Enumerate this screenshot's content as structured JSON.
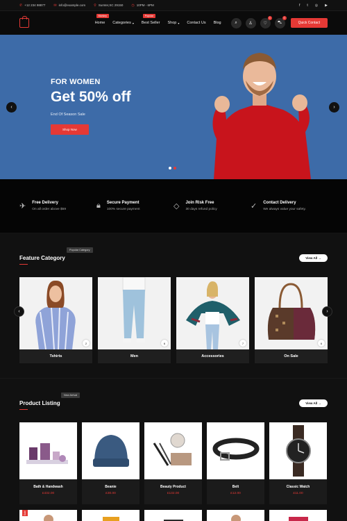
{
  "topbar": {
    "phone": "+12 234 98877",
    "email": "info@example.com",
    "location": "Sumter,SC 29150",
    "hours": "10PM - 6PM",
    "social": [
      "f",
      "t",
      "ig",
      "yt"
    ]
  },
  "nav": {
    "items": [
      {
        "label": "Home",
        "badge": "Monkey",
        "chevron": false
      },
      {
        "label": "Categories",
        "badge": "",
        "chevron": true
      },
      {
        "label": "Best Seller",
        "badge": "Popular",
        "chevron": false
      },
      {
        "label": "Shop",
        "badge": "",
        "chevron": true
      },
      {
        "label": "Contact Us",
        "badge": "",
        "chevron": false
      },
      {
        "label": "Blog",
        "badge": "",
        "chevron": false
      }
    ],
    "wishlist_count": "0",
    "cart_count": "0",
    "quick_contact": "Quick Contact"
  },
  "hero": {
    "kicker": "FOR WOMEN",
    "headline": "Get 50% off",
    "sub": "End Of Season Sale",
    "cta": "Shop Now"
  },
  "features": [
    {
      "icon": "plane-icon",
      "title": "Free Delivery",
      "sub": "On all order above $59"
    },
    {
      "icon": "lock-icon",
      "title": "Secure Payment",
      "sub": "100% secure payment"
    },
    {
      "icon": "diamond-icon",
      "title": "Join Risk Free",
      "sub": "30 days refund policy"
    },
    {
      "icon": "check-icon",
      "title": "Contact Delivery",
      "sub": "We always value your safety."
    }
  ],
  "categories": {
    "title": "Feature Category",
    "tag": "Popular Category",
    "view_all": "View All →",
    "items": [
      {
        "name": "Tshirts",
        "count": "2"
      },
      {
        "name": "Men",
        "count": "6"
      },
      {
        "name": "Accessories",
        "count": "7"
      },
      {
        "name": "On Sale",
        "count": "6"
      }
    ]
  },
  "products": {
    "title": "Product Listing",
    "tag": "New Arrival",
    "view_all": "View All →",
    "items": [
      {
        "name": "Bath & Handwash",
        "price": "£432.00"
      },
      {
        "name": "Beanie",
        "price": "£30.00"
      },
      {
        "name": "Beauty Product",
        "price": "£132.00"
      },
      {
        "name": "Belt",
        "price": "£12.00"
      },
      {
        "name": "Classic Watch",
        "price": "£11.00"
      }
    ],
    "sale_label": "Sale"
  },
  "colors": {
    "accent": "#e53935",
    "hero_bg": "#3d6ba8"
  }
}
